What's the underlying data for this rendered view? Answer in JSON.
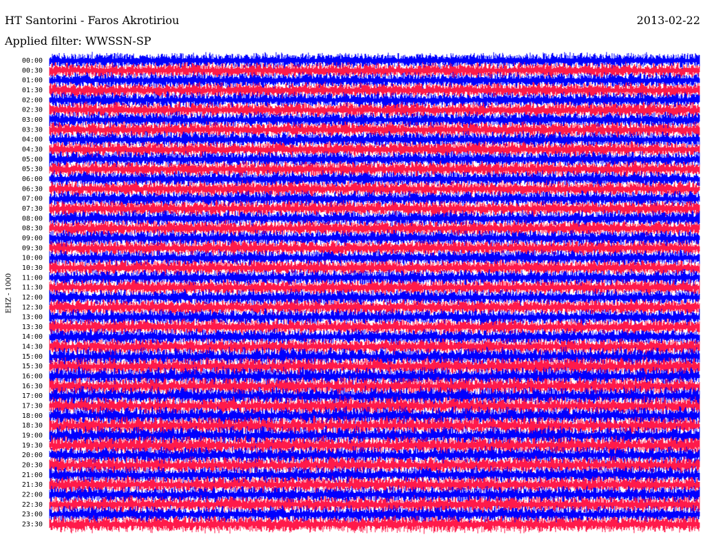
{
  "header": {
    "station": "HT Santorini - Faros Akrotiriou",
    "date": "2013-02-22",
    "filter_text": "Applied filter: WWSSN-SP"
  },
  "chart_data": {
    "type": "helicorder",
    "title": "HT Santorini - Faros Akrotiriou",
    "date": "2013-02-22",
    "filter": "WWSSN-SP",
    "ylabel": "EHZ - 1000",
    "row_labels": [
      "00:00",
      "00:30",
      "01:00",
      "01:30",
      "02:00",
      "02:30",
      "03:00",
      "03:30",
      "04:00",
      "04:30",
      "05:00",
      "05:30",
      "06:00",
      "06:30",
      "07:00",
      "07:30",
      "08:00",
      "08:30",
      "09:00",
      "09:30",
      "10:00",
      "10:30",
      "11:00",
      "11:30",
      "12:00",
      "12:30",
      "13:00",
      "13:30",
      "14:00",
      "14:30",
      "15:00",
      "15:30",
      "16:00",
      "16:30",
      "17:00",
      "17:30",
      "18:00",
      "18:30",
      "19:00",
      "19:30",
      "20:00",
      "20:30",
      "21:00",
      "21:30",
      "22:00",
      "22:30",
      "23:00",
      "23:30"
    ],
    "trace_colors": [
      "#0000ff",
      "#ff1a4a"
    ],
    "background": "#ffffff"
  }
}
